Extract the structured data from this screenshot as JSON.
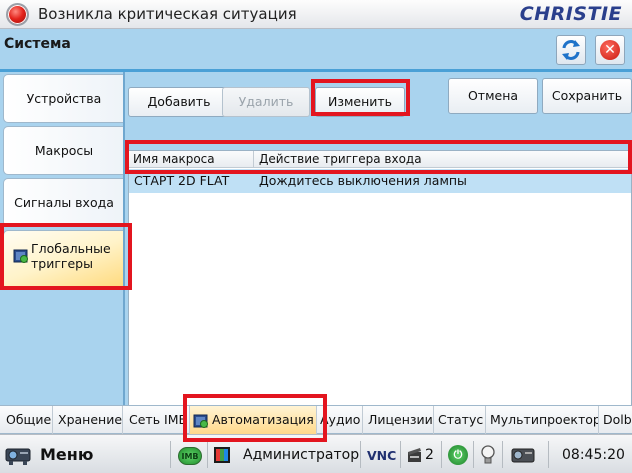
{
  "titlebar": {
    "alert_text": "Возникла критическая ситуация",
    "brand": "CHRISTIE"
  },
  "window": {
    "title": "Система"
  },
  "sidenav": {
    "items": [
      {
        "label": "Устройства"
      },
      {
        "label": "Макросы"
      },
      {
        "label": "Сигналы входа"
      },
      {
        "label": "Глобальные триггеры",
        "active": true
      }
    ]
  },
  "toolbar": {
    "add_label": "Добавить",
    "delete_label": "Удалить",
    "edit_label": "Изменить",
    "cancel_label": "Отмена",
    "save_label": "Сохранить"
  },
  "table": {
    "columns": [
      "Имя макроса",
      "Действие триггера входа"
    ],
    "rows": [
      [
        "СТАРТ 2D FLAT",
        "Дождитесь выключения лампы"
      ]
    ]
  },
  "bottom_tabs": [
    {
      "label": "Общие"
    },
    {
      "label": "Хранение"
    },
    {
      "label": "Сеть IMB"
    },
    {
      "label": "Автоматизация",
      "active": true
    },
    {
      "label": "Аудио"
    },
    {
      "label": "Лицензии"
    },
    {
      "label": "Статус"
    },
    {
      "label": "Мультипроектор"
    },
    {
      "label": "Dolby"
    }
  ],
  "statusbar": {
    "menu_label": "Меню",
    "imb_label": "IMB",
    "user_label": "Администратор",
    "vnc_label": "VNC",
    "film_count": "2",
    "time": "08:45:20"
  },
  "colors": {
    "window_bg": "#a9d3ee",
    "highlight": "#e3151f",
    "active_tab": "#ffd98a",
    "selected_row": "#bfe0f5"
  }
}
